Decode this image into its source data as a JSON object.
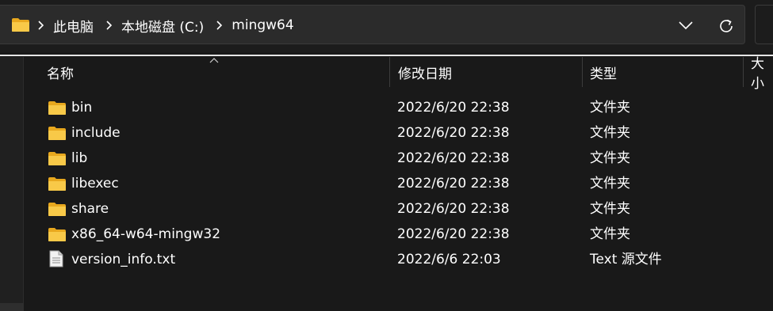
{
  "address_bar": {
    "crumbs": [
      "此电脑",
      "本地磁盘 (C:)",
      "mingw64"
    ],
    "icons": [
      "folder-icon",
      "chevron-right-icon",
      "chevron-down-icon",
      "refresh-icon"
    ]
  },
  "columns": {
    "name": "名称",
    "date": "修改日期",
    "type": "类型",
    "size": "大小"
  },
  "files": [
    {
      "name": "bin",
      "date": "2022/6/20 22:38",
      "type": "文件夹",
      "icon": "folder-icon"
    },
    {
      "name": "include",
      "date": "2022/6/20 22:38",
      "type": "文件夹",
      "icon": "folder-icon"
    },
    {
      "name": "lib",
      "date": "2022/6/20 22:38",
      "type": "文件夹",
      "icon": "folder-icon"
    },
    {
      "name": "libexec",
      "date": "2022/6/20 22:38",
      "type": "文件夹",
      "icon": "folder-icon"
    },
    {
      "name": "share",
      "date": "2022/6/20 22:38",
      "type": "文件夹",
      "icon": "folder-icon"
    },
    {
      "name": "x86_64-w64-mingw32",
      "date": "2022/6/20 22:38",
      "type": "文件夹",
      "icon": "folder-icon"
    },
    {
      "name": "version_info.txt",
      "date": "2022/6/6 22:03",
      "type": "Text 源文件",
      "icon": "text-file-icon"
    }
  ],
  "colors": {
    "background": "#191919",
    "folder": "#f5c542",
    "text": "#ffffff"
  }
}
